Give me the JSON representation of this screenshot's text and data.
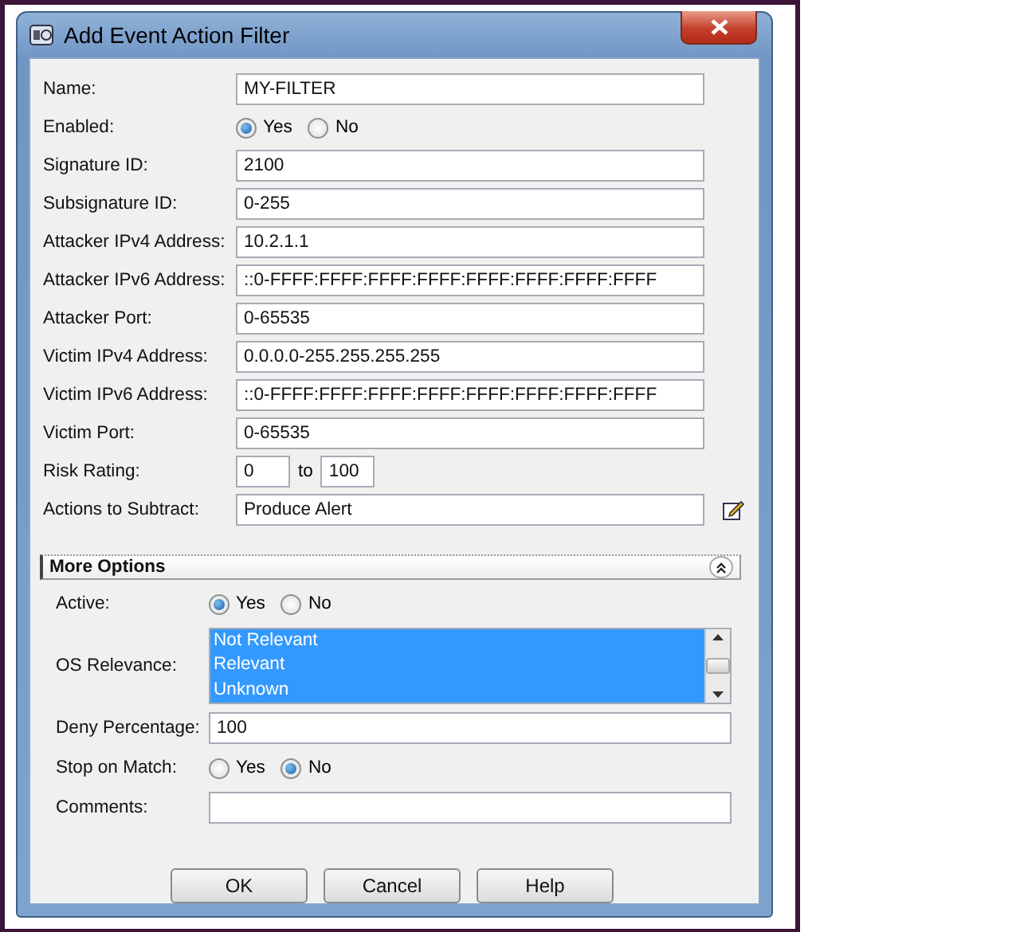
{
  "window": {
    "title": "Add Event Action Filter"
  },
  "fields": [
    {
      "kind": "text",
      "label": "Name:",
      "value": "MY-FILTER"
    },
    {
      "kind": "radio",
      "label": "Enabled:",
      "options": [
        {
          "label": "Yes",
          "selected": true
        },
        {
          "label": "No",
          "selected": false
        }
      ]
    },
    {
      "kind": "text",
      "label": "Signature ID:",
      "value": "2100"
    },
    {
      "kind": "text",
      "label": "Subsignature ID:",
      "value": "0-255"
    },
    {
      "kind": "text",
      "label": "Attacker IPv4 Address:",
      "value": "10.2.1.1"
    },
    {
      "kind": "text",
      "label": "Attacker IPv6 Address:",
      "value": "::0-FFFF:FFFF:FFFF:FFFF:FFFF:FFFF:FFFF:FFFF"
    },
    {
      "kind": "text",
      "label": "Attacker Port:",
      "value": "0-65535"
    },
    {
      "kind": "text",
      "label": "Victim IPv4 Address:",
      "value": "0.0.0.0-255.255.255.255"
    },
    {
      "kind": "text",
      "label": "Victim IPv6 Address:",
      "value": "::0-FFFF:FFFF:FFFF:FFFF:FFFF:FFFF:FFFF:FFFF"
    },
    {
      "kind": "text",
      "label": "Victim Port:",
      "value": "0-65535"
    },
    {
      "kind": "range",
      "label": "Risk Rating:",
      "from": "0",
      "separator": "to",
      "to": "100"
    },
    {
      "kind": "edit",
      "label": "Actions to Subtract:",
      "value": "Produce Alert"
    }
  ],
  "more_options": {
    "title": "More Options",
    "expanded": true,
    "fields": [
      {
        "kind": "radio",
        "label": "Active:",
        "options": [
          {
            "label": "Yes",
            "selected": true
          },
          {
            "label": "No",
            "selected": false
          }
        ]
      },
      {
        "kind": "list",
        "label": "OS Relevance:",
        "items": [
          {
            "label": "Not Relevant",
            "selected": true
          },
          {
            "label": "Relevant",
            "selected": true
          },
          {
            "label": "Unknown",
            "selected": true
          }
        ]
      },
      {
        "kind": "text",
        "label": "Deny Percentage:",
        "value": "100"
      },
      {
        "kind": "radio",
        "label": "Stop on Match:",
        "options": [
          {
            "label": "Yes",
            "selected": false
          },
          {
            "label": "No",
            "selected": true
          }
        ]
      },
      {
        "kind": "text",
        "label": "Comments:"
      }
    ]
  },
  "buttons": [
    "OK",
    "Cancel",
    "Help"
  ]
}
